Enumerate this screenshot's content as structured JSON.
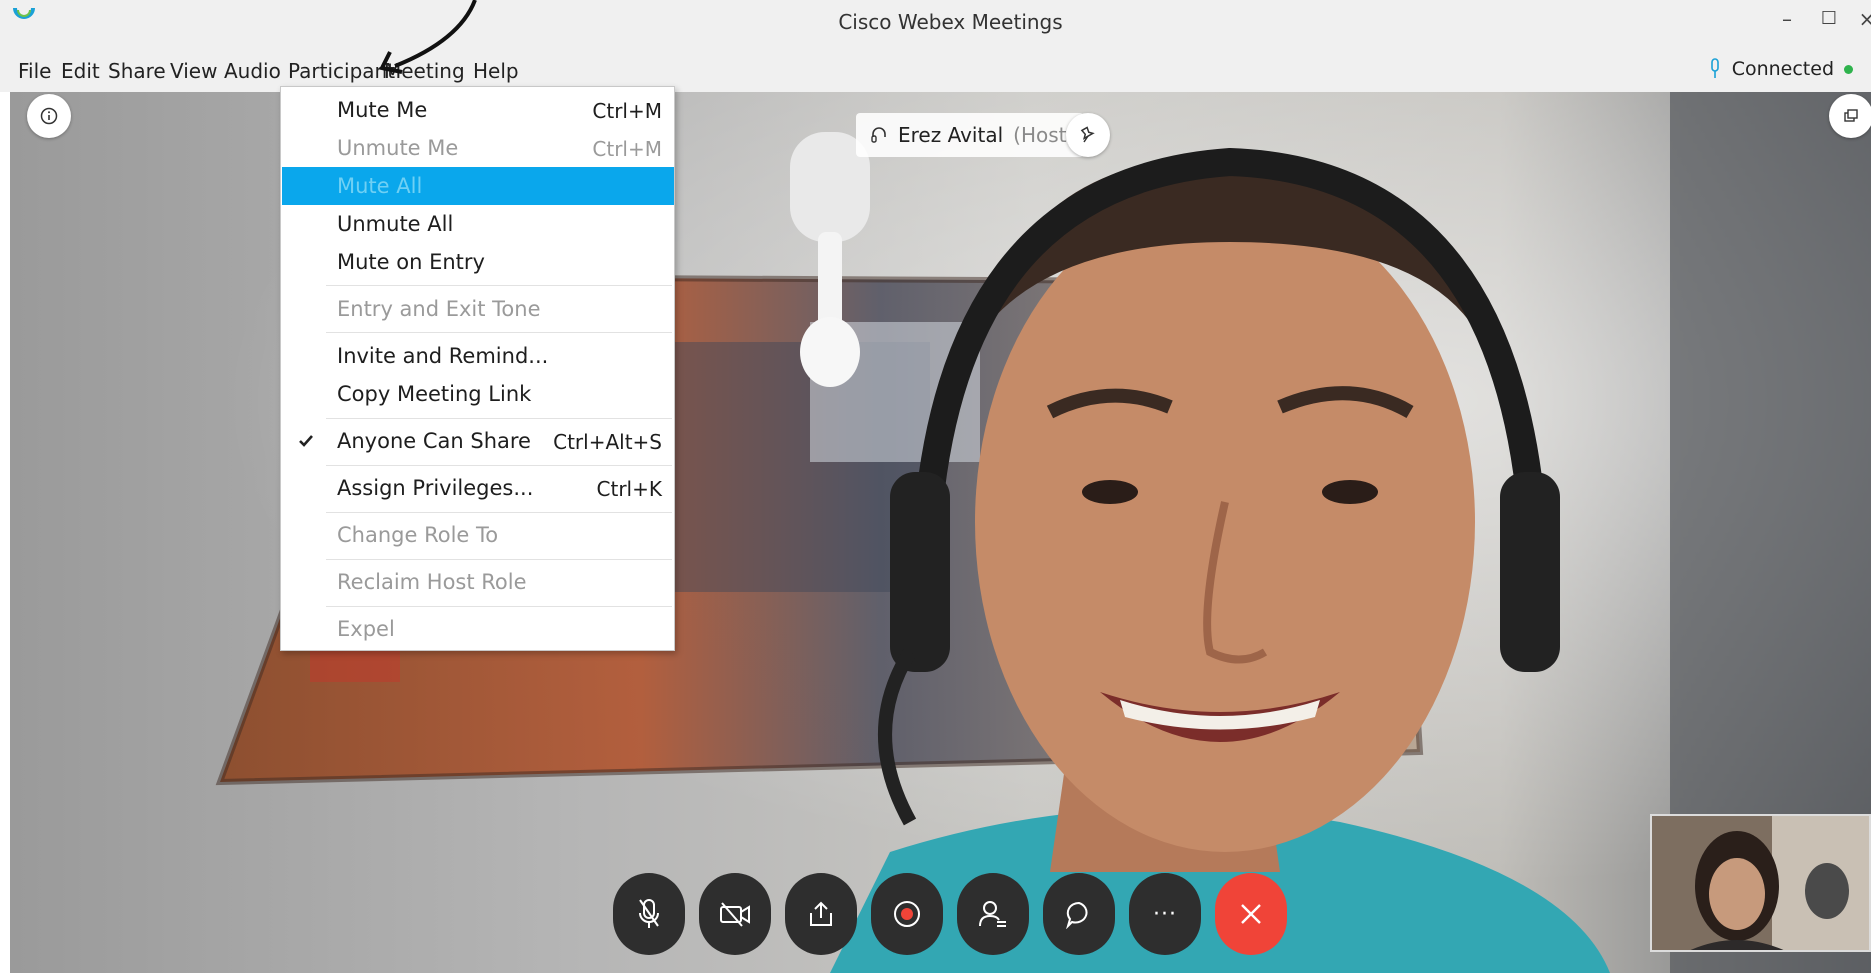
{
  "window": {
    "title": "Cisco Webex Meetings",
    "minimize_label": "–",
    "maximize_label": "☐",
    "close_label": "×"
  },
  "menubar": {
    "items": [
      "File",
      "Edit",
      "Share",
      "View",
      "Audio",
      "Participant",
      "Meeting",
      "Help"
    ],
    "status": "Connected"
  },
  "participant_menu": {
    "items": [
      {
        "label": "Mute Me",
        "shortcut": "Ctrl+M",
        "state": "enabled"
      },
      {
        "label": "Unmute Me",
        "shortcut": "Ctrl+M",
        "state": "disabled"
      },
      {
        "label": "Mute All",
        "shortcut": "",
        "state": "highlighted"
      },
      {
        "label": "Unmute All",
        "shortcut": "",
        "state": "enabled"
      },
      {
        "label": "Mute on Entry",
        "shortcut": "",
        "state": "enabled"
      },
      {
        "label": "Entry and Exit Tone",
        "shortcut": "",
        "state": "disabled"
      },
      {
        "label": "Invite and Remind...",
        "shortcut": "",
        "state": "enabled"
      },
      {
        "label": "Copy Meeting Link",
        "shortcut": "",
        "state": "enabled"
      },
      {
        "label": "Anyone Can Share",
        "shortcut": "Ctrl+Alt+S",
        "state": "checked"
      },
      {
        "label": "Assign Privileges...",
        "shortcut": "Ctrl+K",
        "state": "enabled"
      },
      {
        "label": "Change Role To",
        "shortcut": "",
        "state": "disabled"
      },
      {
        "label": "Reclaim Host Role",
        "shortcut": "",
        "state": "disabled"
      },
      {
        "label": "Expel",
        "shortcut": "",
        "state": "disabled"
      }
    ]
  },
  "meeting": {
    "speaker_name": "Erez Avital",
    "speaker_role": "(Host)"
  },
  "controls": {
    "more_label": "···",
    "icons": [
      "mic-muted-icon",
      "camera-off-icon",
      "share-icon",
      "record-icon",
      "participants-icon",
      "chat-icon",
      "more-icon",
      "end-call-icon"
    ]
  },
  "colors": {
    "menu_highlight": "#0aa7ec",
    "end_call": "#f04438",
    "control_bg": "#2e2e2e",
    "connected_dot": "#2fb34d"
  }
}
